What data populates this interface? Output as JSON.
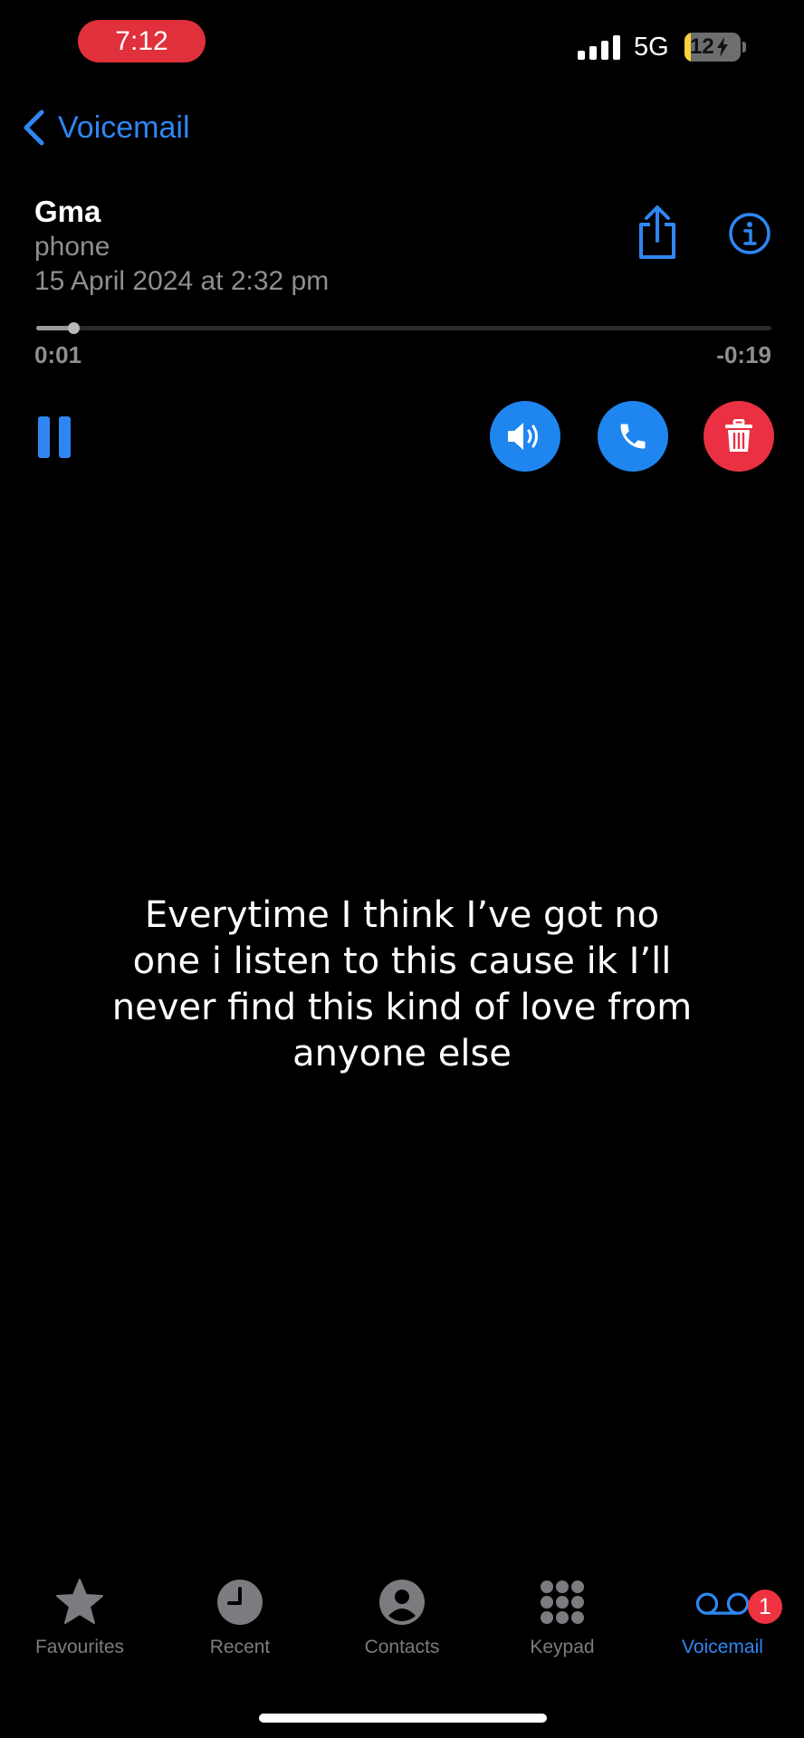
{
  "status_bar": {
    "time": "7:12",
    "network": "5G",
    "battery_level": "12",
    "battery_fraction": 0.12,
    "time_pill_color": "#e0303b"
  },
  "nav": {
    "back_label": "Voicemail"
  },
  "voicemail": {
    "contact_name": "Gma",
    "label": "phone",
    "date": "15 April 2024 at 2:32 pm",
    "elapsed": "0:01",
    "remaining": "-0:19",
    "progress_fraction": 0.05
  },
  "controls": {
    "pause_icon": "pause-icon",
    "speaker_icon": "speaker-icon",
    "call_icon": "phone-icon",
    "delete_icon": "trash-icon"
  },
  "caption": {
    "text": "Everytime I think I’ve got no one i listen to this cause ik I’ll never find this kind of love from anyone else"
  },
  "tab_bar": {
    "tabs": [
      {
        "label": "Favourites",
        "icon": "star-icon",
        "active": false
      },
      {
        "label": "Recent",
        "icon": "clock-icon",
        "active": false
      },
      {
        "label": "Contacts",
        "icon": "person-icon",
        "active": false
      },
      {
        "label": "Keypad",
        "icon": "keypad-icon",
        "active": false
      },
      {
        "label": "Voicemail",
        "icon": "voicemail-icon",
        "active": true
      }
    ],
    "voicemail_badge": "1"
  },
  "colors": {
    "accent": "#2f86f2",
    "destructive": "#ea3042",
    "secondary_text": "#8e8e93"
  }
}
